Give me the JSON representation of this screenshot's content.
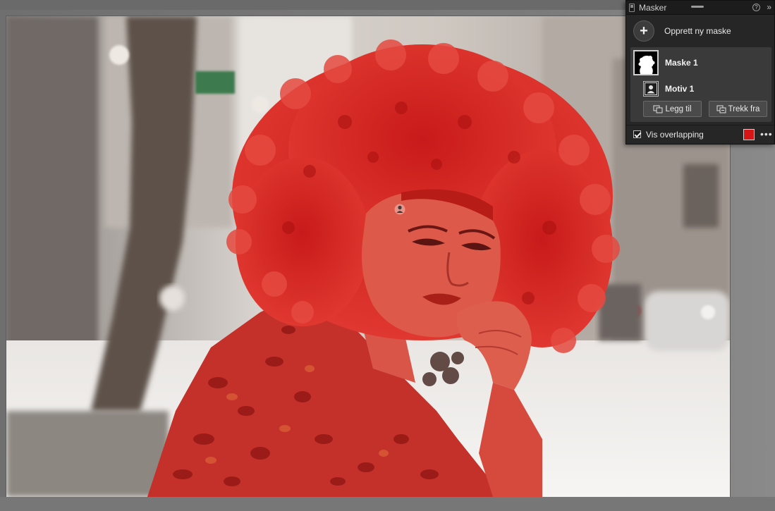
{
  "panel": {
    "title": "Masker",
    "help_icon": "?",
    "expand_icon": "»",
    "create_mask_label": "Opprett ny maske",
    "plus_icon": "+",
    "mask_name": "Maske 1",
    "motif_name": "Motiv 1",
    "add_label": "Legg til",
    "subtract_label": "Trekk fra",
    "overlay_label": "Vis overlapping",
    "overlay_checked": true,
    "overlay_color": "#d61616",
    "more_icon": "•••"
  },
  "icons": {
    "grip": "panel-grip-icon",
    "help": "help-icon",
    "expand": "expand-icon",
    "plus": "plus-icon",
    "mask_thumb": "person-silhouette-icon",
    "motif_thumb": "person-icon",
    "add": "brush-add-icon",
    "subtract": "brush-subtract-icon",
    "cursor": "person-target-icon"
  },
  "colors": {
    "panel_bg": "#262626",
    "mask_group_bg": "#3a3a3a",
    "overlay_red": "#d61616"
  }
}
